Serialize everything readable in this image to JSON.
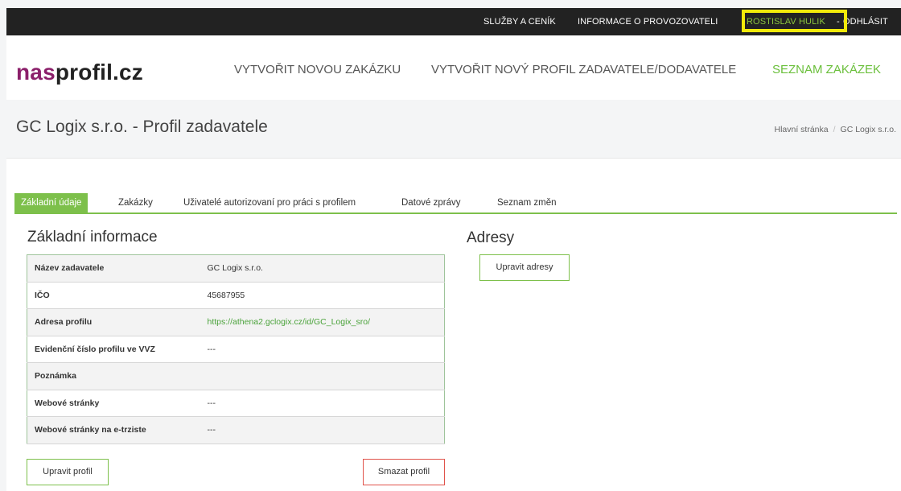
{
  "topbar": {
    "services": "SLUŽBY A CENÍK",
    "operator_info": "INFORMACE O PROVOZOVATELI",
    "user": "ROSTISLAV HULIK",
    "separator": "-",
    "logout": "ODHLÁSIT"
  },
  "header": {
    "logo_part1": "nas",
    "logo_part2": "profil.cz",
    "nav": {
      "new_contract": "VYTVOŘIT NOVOU ZAKÁZKU",
      "new_profile": "VYTVOŘIT NOVÝ PROFIL ZADAVATELE/DODAVATELE",
      "contract_list": "SEZNAM ZAKÁZEK"
    }
  },
  "page": {
    "title": "GC Logix s.r.o. - Profil zadavatele",
    "breadcrumbs": [
      "Hlavní stránka",
      "/",
      "GC Logix s.r.o."
    ]
  },
  "tabs": [
    {
      "label": "Základní údaje",
      "active": true
    },
    {
      "label": "Zakázky"
    },
    {
      "label": "Uživatelé autorizovaní pro práci s profilem"
    },
    {
      "label": "Datové zprávy"
    },
    {
      "label": "Seznam změn"
    }
  ],
  "basic_info": {
    "heading": "Základní informace",
    "rows": [
      {
        "key": "Název zadavatele",
        "value": "GC Logix s.r.o."
      },
      {
        "key": "IČO",
        "value": "45687955"
      },
      {
        "key": "Adresa profilu",
        "value": "https://athena2.gclogix.cz/id/GC_Logix_sro/"
      },
      {
        "key": "Evidenční číslo profilu ve VVZ",
        "value": "---"
      },
      {
        "key": "Poznámka",
        "value": ""
      },
      {
        "key": "Webové stránky",
        "value": "---"
      },
      {
        "key": "Webové stránky na e-trziste",
        "value": "---"
      }
    ],
    "edit_button": "Upravit profil",
    "delete_button": "Smazat profil"
  },
  "addresses": {
    "heading": "Adresy",
    "edit_button": "Upravit adresy"
  },
  "colors": {
    "accent_green": "#7dc04b",
    "logo_purple": "#8b1f6a",
    "highlight_yellow": "#f1ea0a",
    "danger_red": "#e0524a"
  }
}
